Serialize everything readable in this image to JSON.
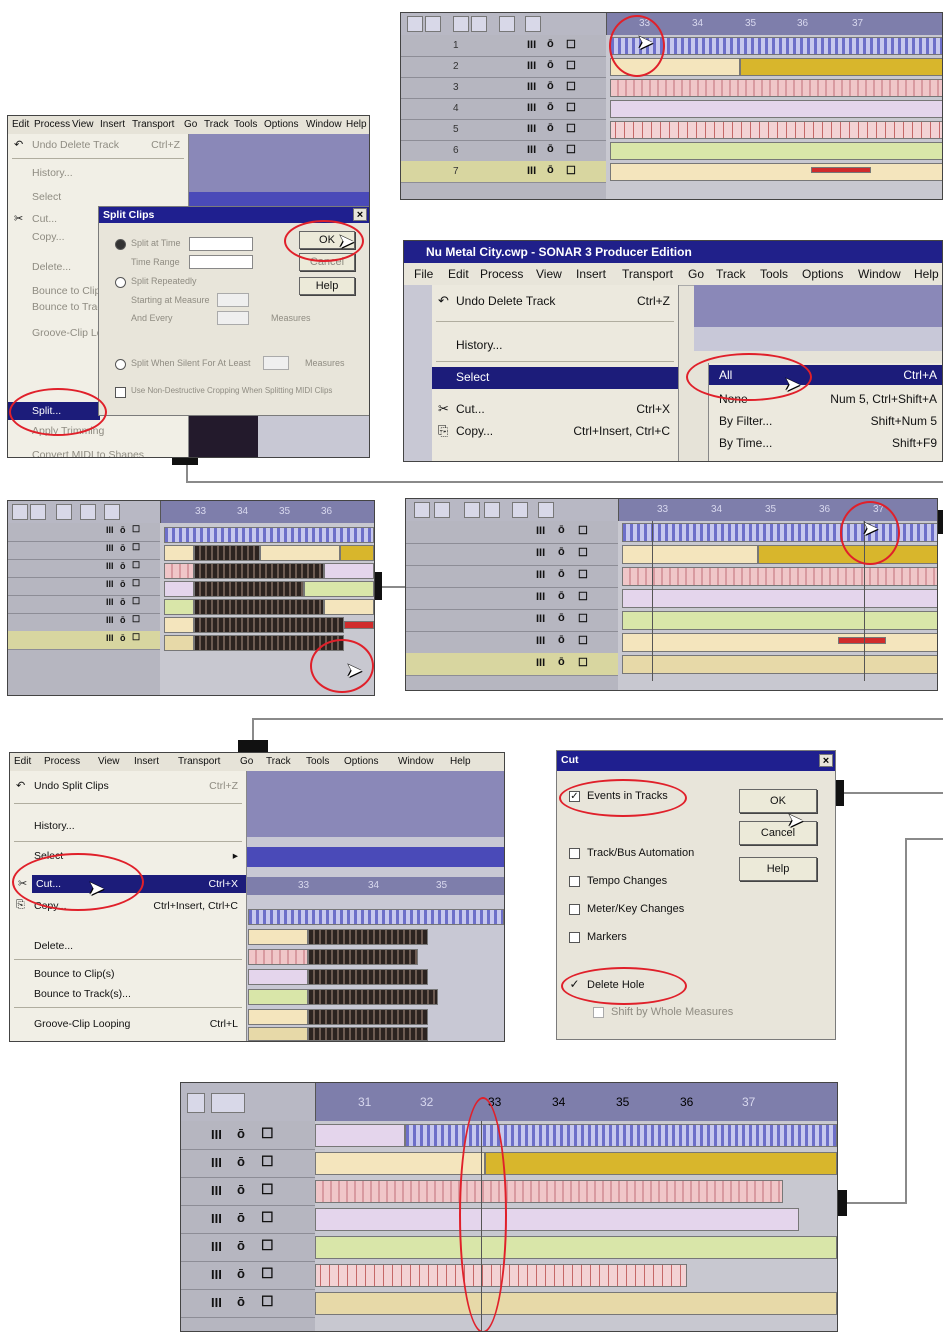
{
  "track_icons": {
    "mute": "III",
    "solo": "ō",
    "record": "☐"
  },
  "panel_seq_a": {
    "ruler": [
      "33",
      "34",
      "35",
      "36",
      "37"
    ],
    "tracks": [
      "1",
      "2",
      "3",
      "4",
      "5",
      "6",
      "7"
    ]
  },
  "panel_split": {
    "menubar": [
      "Edit",
      "Process",
      "View",
      "Insert",
      "Transport",
      "Go",
      "Track",
      "Tools",
      "Options",
      "Window",
      "Help"
    ],
    "menu_items": [
      "Undo Delete Track",
      "History...",
      "Select",
      "Cut...",
      "Copy...",
      "Delete...",
      "Bounce to Clip(s)",
      "Bounce to Track(s)...",
      "Groove-Clip Looping",
      "Split...",
      "Apply Trimming",
      "Convert MIDI to Shapes"
    ],
    "undo_shortcut": "Ctrl+Z",
    "dialog": {
      "title": "Split Clips",
      "options": [
        "Split at Time",
        "Time Range",
        "Split Repeatedly",
        "Starting at Measure",
        "And Every",
        "Measures",
        "Split When Silent For At Least",
        "Measures",
        "Use Non-Destructive Cropping When Splitting MIDI Clips"
      ],
      "ok": "OK",
      "cancel": "Cancel",
      "help": "Help"
    }
  },
  "panel_sonar": {
    "title": "Nu Metal City.cwp - SONAR 3 Producer Edition",
    "menubar": [
      "File",
      "Edit",
      "Process",
      "View",
      "Insert",
      "Transport",
      "Go",
      "Track",
      "Tools",
      "Options",
      "Window",
      "Help"
    ],
    "edit_menu": [
      {
        "label": "Undo Delete Track",
        "shortcut": "Ctrl+Z"
      },
      {
        "label": "History...",
        "shortcut": ""
      },
      {
        "label": "Select",
        "shortcut": ""
      },
      {
        "label": "Cut...",
        "shortcut": "Ctrl+X"
      },
      {
        "label": "Copy...",
        "shortcut": "Ctrl+Insert, Ctrl+C"
      }
    ],
    "select_submenu": [
      {
        "label": "All",
        "shortcut": "Ctrl+A"
      },
      {
        "label": "None",
        "shortcut": "Num 5, Ctrl+Shift+A"
      },
      {
        "label": "By Filter...",
        "shortcut": "Shift+Num 5"
      },
      {
        "label": "By Time...",
        "shortcut": "Shift+F9"
      }
    ]
  },
  "panel_seq_c": {
    "ruler": [
      "33",
      "34",
      "35",
      "36"
    ]
  },
  "panel_seq_d": {
    "ruler": [
      "33",
      "34",
      "35",
      "36",
      "37"
    ]
  },
  "panel_cut_menu": {
    "menubar": [
      "Edit",
      "Process",
      "View",
      "Insert",
      "Transport",
      "Go",
      "Track",
      "Tools",
      "Options",
      "Window",
      "Help"
    ],
    "items": [
      {
        "label": "Undo Split Clips",
        "shortcut": "Ctrl+Z"
      },
      {
        "label": "History...",
        "shortcut": ""
      },
      {
        "label": "Select",
        "shortcut": ""
      },
      {
        "label": "Cut...",
        "shortcut": "Ctrl+X"
      },
      {
        "label": "Copy...",
        "shortcut": "Ctrl+Insert, Ctrl+C"
      },
      {
        "label": "Delete...",
        "shortcut": ""
      },
      {
        "label": "Bounce to Clip(s)",
        "shortcut": ""
      },
      {
        "label": "Bounce to Track(s)...",
        "shortcut": ""
      },
      {
        "label": "Groove-Clip Looping",
        "shortcut": "Ctrl+L"
      }
    ],
    "ruler": [
      "33",
      "34",
      "35"
    ]
  },
  "panel_cut_dialog": {
    "title": "Cut",
    "checkboxes": [
      {
        "label": "Events in Tracks",
        "checked": true
      },
      {
        "label": "Track/Bus Automation",
        "checked": false
      },
      {
        "label": "Tempo Changes",
        "checked": false
      },
      {
        "label": "Meter/Key Changes",
        "checked": false
      },
      {
        "label": "Markers",
        "checked": false
      },
      {
        "label": "Delete Hole",
        "checked": true
      },
      {
        "label": "Shift by Whole Measures",
        "checked": false
      }
    ],
    "ok": "OK",
    "cancel": "Cancel",
    "help": "Help"
  },
  "panel_seq_final": {
    "ruler": [
      "31",
      "32",
      "33",
      "34",
      "35",
      "36",
      "37"
    ]
  }
}
